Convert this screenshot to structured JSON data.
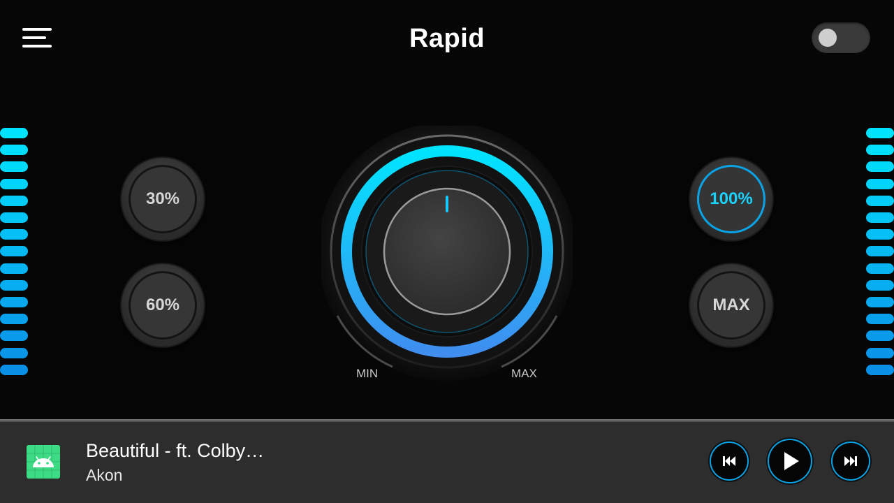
{
  "header": {
    "title": "Rapid",
    "menu_icon": "hamburger-menu-icon",
    "toggle_on": false
  },
  "colors": {
    "accent_cyan": "#00e5ff",
    "accent_blue": "#3f8ef0",
    "background": "#060606",
    "player_bar": "#2d2d2d"
  },
  "meters": {
    "segment_count": 15,
    "level": 1.0
  },
  "presets": {
    "p30": "30%",
    "p60": "60%",
    "p100": "100%",
    "max": "MAX",
    "active": "p100"
  },
  "knob": {
    "min_label": "MIN",
    "max_label": "MAX",
    "value_percent": 100
  },
  "player": {
    "title": "Beautiful - ft. Colby…",
    "artist": "Akon",
    "album_icon": "android-icon",
    "prev_icon": "skip-previous-icon",
    "play_icon": "play-icon",
    "next_icon": "skip-next-icon"
  }
}
